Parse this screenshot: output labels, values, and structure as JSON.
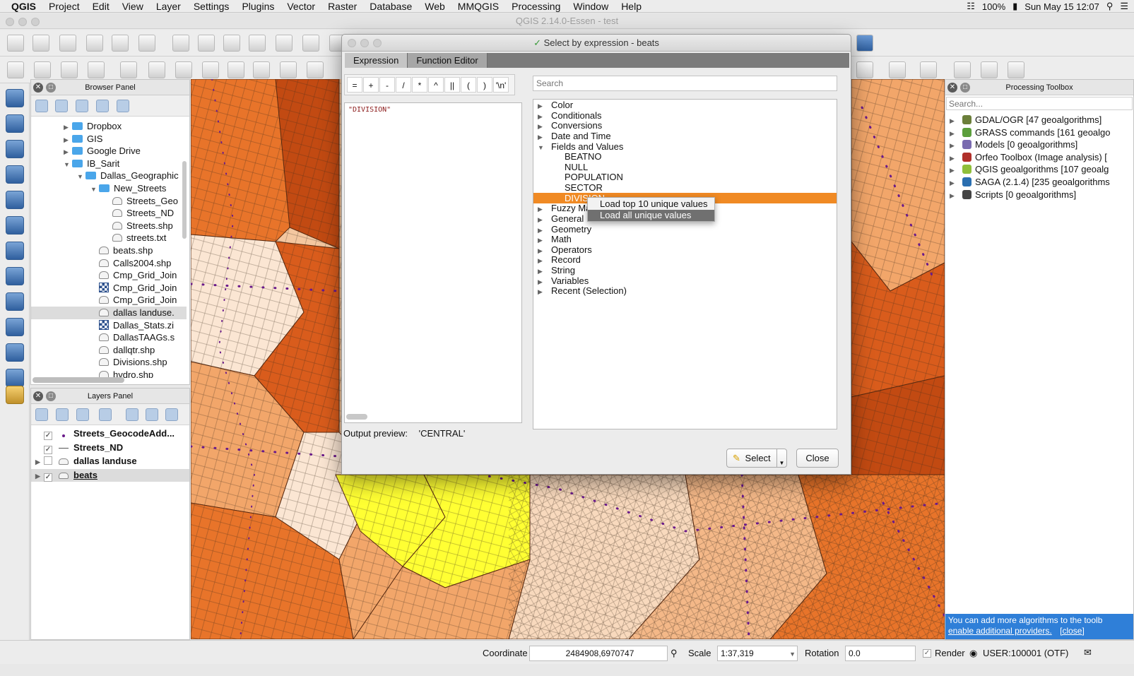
{
  "menubar": {
    "app": "QGIS",
    "items": [
      "Project",
      "Edit",
      "View",
      "Layer",
      "Settings",
      "Plugins",
      "Vector",
      "Raster",
      "Database",
      "Web",
      "MMQGIS",
      "Processing",
      "Window",
      "Help"
    ],
    "battery": "100%",
    "clock": "Sun May 15  12:07"
  },
  "window_title": "QGIS 2.14.0-Essen - test",
  "browser": {
    "title": "Browser Panel",
    "rows": [
      {
        "label": "Dropbox",
        "kind": "folder",
        "depth": 1,
        "exp": "right"
      },
      {
        "label": "GIS",
        "kind": "folder",
        "depth": 1,
        "exp": "right"
      },
      {
        "label": "Google Drive",
        "kind": "folder",
        "depth": 1,
        "exp": "right"
      },
      {
        "label": "IB_Sarit",
        "kind": "folder",
        "depth": 1,
        "exp": "down"
      },
      {
        "label": "Dallas_Geographic",
        "kind": "folder",
        "depth": 2,
        "exp": "down"
      },
      {
        "label": "New_Streets",
        "kind": "folder",
        "depth": 3,
        "exp": "down"
      },
      {
        "label": "Streets_Geo",
        "kind": "file",
        "depth": 4,
        "exp": ""
      },
      {
        "label": "Streets_ND",
        "kind": "file",
        "depth": 4,
        "exp": ""
      },
      {
        "label": "Streets.shp",
        "kind": "file",
        "depth": 4,
        "exp": ""
      },
      {
        "label": "streets.txt",
        "kind": "file",
        "depth": 4,
        "exp": ""
      },
      {
        "label": "beats.shp",
        "kind": "file",
        "depth": 3,
        "exp": ""
      },
      {
        "label": "Calls2004.shp",
        "kind": "file",
        "depth": 3,
        "exp": ""
      },
      {
        "label": "Cmp_Grid_Join",
        "kind": "file",
        "depth": 3,
        "exp": ""
      },
      {
        "label": "Cmp_Grid_Join",
        "kind": "raster",
        "depth": 3,
        "exp": ""
      },
      {
        "label": "Cmp_Grid_Join",
        "kind": "file",
        "depth": 3,
        "exp": ""
      },
      {
        "label": "dallas landuse.",
        "kind": "file",
        "depth": 3,
        "exp": ""
      },
      {
        "label": "Dallas_Stats.zi",
        "kind": "raster",
        "depth": 3,
        "exp": ""
      },
      {
        "label": "DallasTAAGs.s",
        "kind": "file",
        "depth": 3,
        "exp": ""
      },
      {
        "label": "dallqtr.shp",
        "kind": "file",
        "depth": 3,
        "exp": ""
      },
      {
        "label": "Divisions.shp",
        "kind": "file",
        "depth": 3,
        "exp": ""
      },
      {
        "label": "hydro.shp",
        "kind": "file",
        "depth": 3,
        "exp": ""
      }
    ]
  },
  "layers": {
    "title": "Layers Panel",
    "rows": [
      {
        "label": "Streets_GeocodeAdd...",
        "checked": true,
        "sym": "dot"
      },
      {
        "label": "Streets_ND",
        "checked": true,
        "sym": "line"
      },
      {
        "label": "dallas landuse",
        "checked": false,
        "sym": "poly"
      },
      {
        "label": "beats",
        "checked": true,
        "sym": "poly"
      }
    ]
  },
  "dialog": {
    "title": "Select by expression - beats",
    "tabs": [
      "Expression",
      "Function Editor"
    ],
    "operators": [
      "=",
      "+",
      "-",
      "/",
      "*",
      "^",
      "||",
      "(",
      ")",
      "'\\n'"
    ],
    "expression": "\"DIVISION\"",
    "search_placeholder": "Search",
    "functions": [
      {
        "label": "Color",
        "exp": "right",
        "depth": 0
      },
      {
        "label": "Conditionals",
        "exp": "right",
        "depth": 0
      },
      {
        "label": "Conversions",
        "exp": "right",
        "depth": 0
      },
      {
        "label": "Date and Time",
        "exp": "right",
        "depth": 0
      },
      {
        "label": "Fields and Values",
        "exp": "down",
        "depth": 0
      },
      {
        "label": "BEATNO",
        "exp": "",
        "depth": 1
      },
      {
        "label": "NULL",
        "exp": "",
        "depth": 1
      },
      {
        "label": "POPULATION",
        "exp": "",
        "depth": 1
      },
      {
        "label": "SECTOR",
        "exp": "",
        "depth": 1
      },
      {
        "label": "DIVISION",
        "exp": "",
        "depth": 1
      },
      {
        "label": "Fuzzy Ma",
        "exp": "right",
        "depth": 0
      },
      {
        "label": "General",
        "exp": "right",
        "depth": 0
      },
      {
        "label": "Geometry",
        "exp": "right",
        "depth": 0
      },
      {
        "label": "Math",
        "exp": "right",
        "depth": 0
      },
      {
        "label": "Operators",
        "exp": "right",
        "depth": 0
      },
      {
        "label": "Record",
        "exp": "right",
        "depth": 0
      },
      {
        "label": "String",
        "exp": "right",
        "depth": 0
      },
      {
        "label": "Variables",
        "exp": "right",
        "depth": 0
      },
      {
        "label": "Recent (Selection)",
        "exp": "right",
        "depth": 0
      }
    ],
    "output_label": "Output preview:",
    "output_value": "'CENTRAL'",
    "select_label": "Select",
    "close_label": "Close"
  },
  "context_menu": [
    "Load top 10 unique values",
    "Load all unique values"
  ],
  "processing": {
    "title": "Processing Toolbox",
    "search_placeholder": "Search...",
    "rows": [
      {
        "label": "GDAL/OGR [47 geoalgorithms]",
        "color": "#6b7f3a"
      },
      {
        "label": "GRASS commands [161 geoalgo",
        "color": "#5b9e3c"
      },
      {
        "label": "Models [0 geoalgorithms]",
        "color": "#7a6bb0"
      },
      {
        "label": "Orfeo Toolbox (Image analysis) [",
        "color": "#b0302a"
      },
      {
        "label": "QGIS geoalgorithms [107 geoalg",
        "color": "#8fbf3a"
      },
      {
        "label": "SAGA (2.1.4) [235 geoalgorithms",
        "color": "#2a6fb0"
      },
      {
        "label": "Scripts [0 geoalgorithms]",
        "color": "#444444"
      }
    ],
    "tip_text": "You can add more algorithms to the toolb",
    "tip_link": "enable additional providers.",
    "tip_close": "[close]"
  },
  "status": {
    "coord_label": "Coordinate",
    "coord_value": "2484908,6970747",
    "scale_label": "Scale",
    "scale_value": "1:37,319",
    "rotation_label": "Rotation",
    "rotation_value": "0.0",
    "render_label": "Render",
    "crs": "USER:100001 (OTF)"
  },
  "colors": {
    "accent": "#f08a24",
    "map_dark": "#c24a12",
    "map_mid": "#e8742a",
    "map_light": "#f2a66a",
    "map_pale": "#f8d9bd",
    "highlight": "#ffff33",
    "points": "#6a1a8a"
  }
}
